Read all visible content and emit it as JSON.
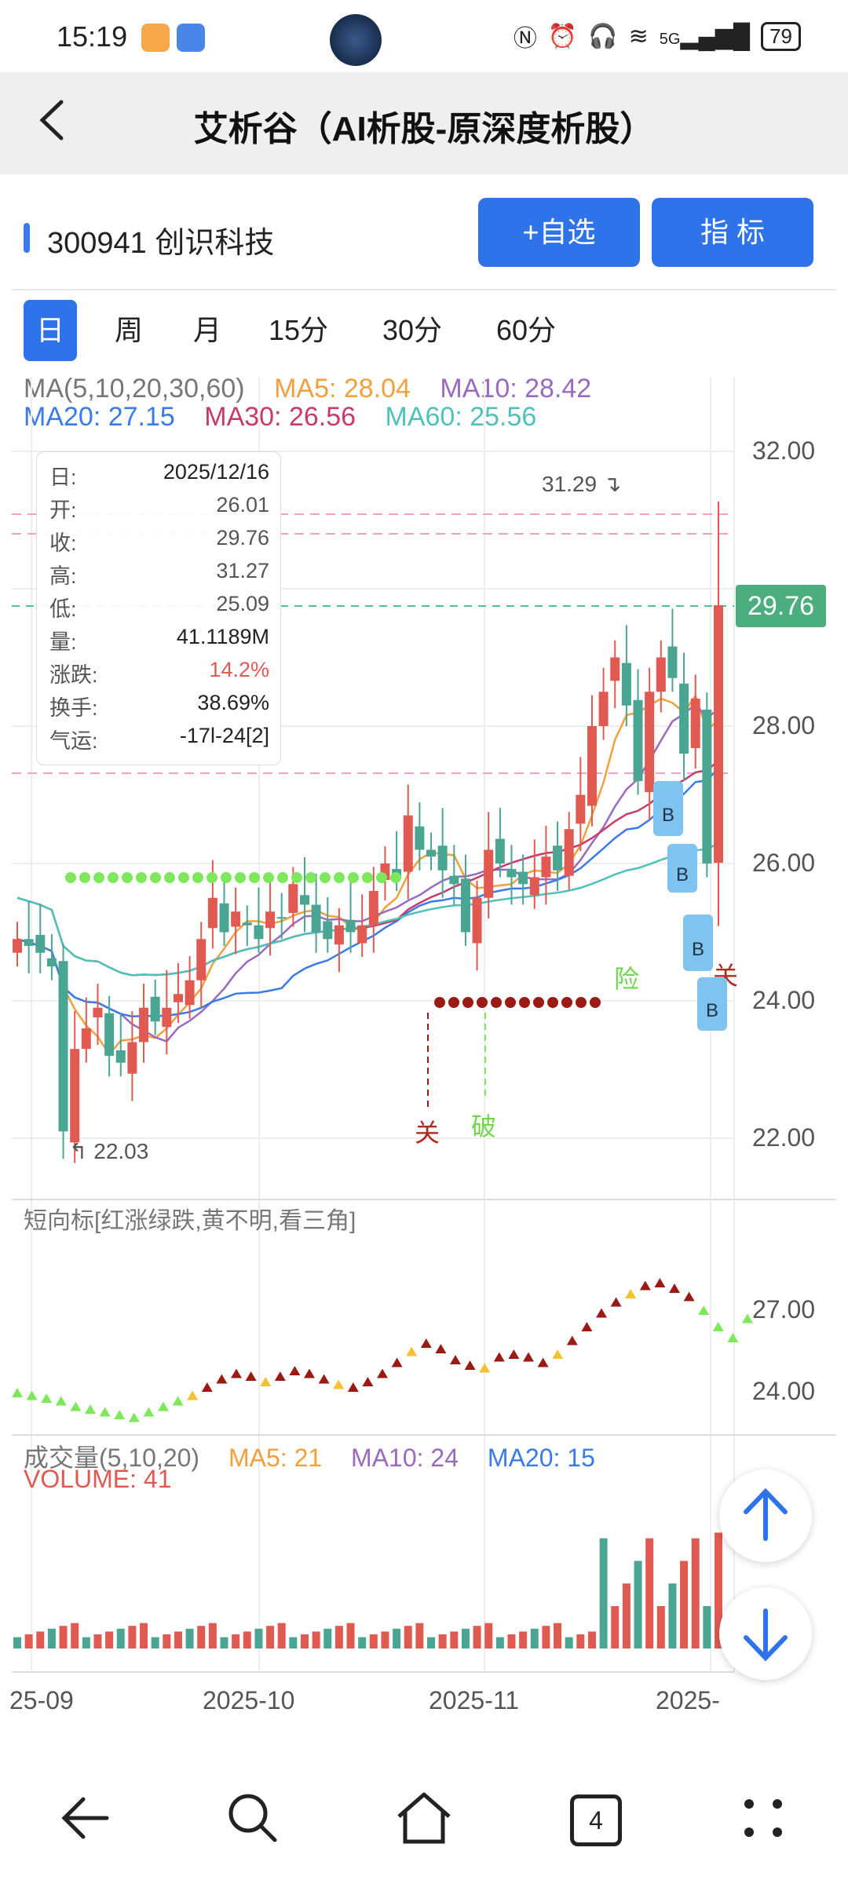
{
  "status_bar": {
    "time": "15:19",
    "battery": "79",
    "network": "5G"
  },
  "header": {
    "title": "艾析谷（AI析股-原深度析股）"
  },
  "stock": {
    "code_name": "300941 创识科技"
  },
  "buttons": {
    "add_watch": "+自选",
    "indicator": "指  标"
  },
  "period_tabs": [
    "日",
    "周",
    "月",
    "15分",
    "30分",
    "60分"
  ],
  "active_tab": "日",
  "ma_legend": {
    "title": "MA(5,10,20,30,60)",
    "ma5": "MA5: 28.04",
    "ma10": "MA10: 28.42",
    "ma20": "MA20: 27.15",
    "ma30": "MA30: 26.56",
    "ma60": "MA60: 25.56"
  },
  "colors": {
    "ma5": "#f0a03c",
    "ma10": "#9a6ac0",
    "ma20": "#3a7be8",
    "ma30": "#c83a6a",
    "ma60": "#4ec2b8",
    "up": "#e05a52",
    "down": "#4aa593",
    "accent": "#2f73ea"
  },
  "info_box": {
    "rows": [
      {
        "label": "日:",
        "value": "2025/12/16"
      },
      {
        "label": "开:",
        "value": "26.01"
      },
      {
        "label": "收:",
        "value": "29.76"
      },
      {
        "label": "高:",
        "value": "31.27"
      },
      {
        "label": "低:",
        "value": "25.09"
      },
      {
        "label": "量:",
        "value": "41.1189M"
      },
      {
        "label": "涨跌:",
        "value": "14.2%"
      },
      {
        "label": "换手:",
        "value": "38.69%"
      },
      {
        "label": "气运:",
        "value": "-17l-24[2]"
      }
    ]
  },
  "price_axis": [
    "32.00",
    "28.00",
    "26.00",
    "24.00",
    "22.00"
  ],
  "current_price": "29.76",
  "high_label": "31.29",
  "low_label": "22.03",
  "chart_marks": {
    "guan1": "关",
    "po": "破",
    "xian": "险",
    "guan2": "关",
    "buy": "B"
  },
  "short_indicator": {
    "title": "短向标[红涨绿跌,黄不明,看三角]",
    "axis": [
      "27.00",
      "24.00"
    ]
  },
  "volume": {
    "title": "成交量(5,10,20)",
    "ma5": "MA5: 21",
    "ma10": "MA10: 24",
    "ma20": "MA20: 15",
    "volume": "VOLUME: 41"
  },
  "x_axis": [
    "25-09",
    "2025-10",
    "2025-11",
    "2025-"
  ],
  "nav": {
    "tabs_count": "4"
  },
  "chart_data": {
    "type": "candlestick",
    "closes": [
      24.9,
      24.8,
      24.7,
      24.5,
      22.1,
      23.3,
      23.6,
      23.9,
      23.2,
      23.1,
      23.4,
      23.9,
      23.7,
      23.9,
      24.1,
      24.3,
      24.9,
      25.5,
      25.0,
      25.3,
      25.1,
      24.9,
      25.3,
      25.2,
      25.7,
      25.4,
      25.0,
      24.9,
      25.1,
      25.0,
      25.1,
      25.6,
      26.0,
      25.8,
      26.7,
      26.2,
      26.1,
      25.9,
      25.7,
      25.0,
      25.5,
      26.2,
      26.0,
      25.8,
      25.7,
      25.8,
      26.1,
      25.9,
      26.5,
      27.0,
      28.0,
      28.5,
      29.0,
      28.3,
      27.2,
      28.5,
      29.0,
      28.7,
      27.6,
      28.4,
      26.0,
      29.76
    ],
    "volume_last": 41
  }
}
